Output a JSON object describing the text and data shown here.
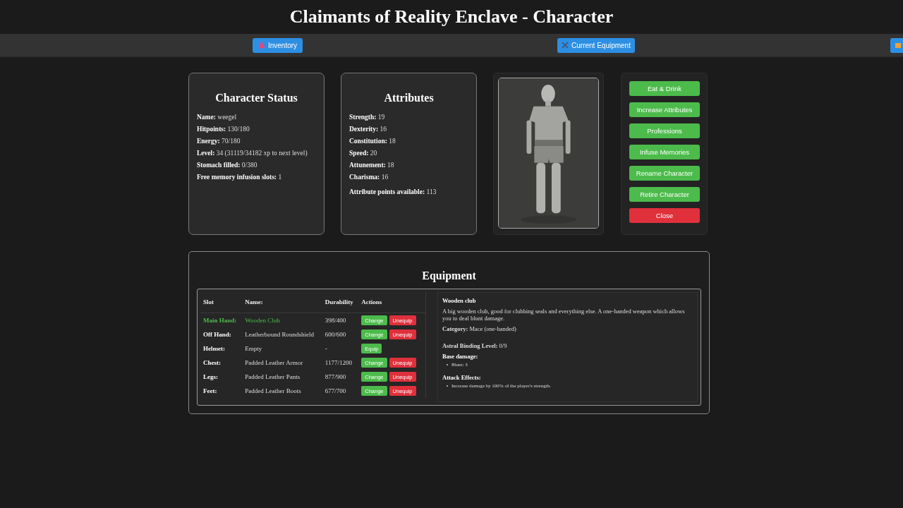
{
  "title": "Claimants of Reality Enclave - Character",
  "nav": [
    {
      "kind": "labeled",
      "label": "Inventory"
    },
    {
      "kind": "labeled",
      "label": "Current Equipment"
    },
    {
      "kind": "icon"
    }
  ],
  "status": {
    "title": "Character Status",
    "fields": [
      {
        "label": "Name:",
        "value": "weegel"
      },
      {
        "label": "Hitpoints:",
        "value": "130/180"
      },
      {
        "label": "Energy:",
        "value": "70/180"
      },
      {
        "label": "Level:",
        "value": "34 (31119/34182 xp to next level)"
      },
      {
        "label": "Stomach filled:",
        "value": "0/380"
      },
      {
        "label": "Free memory infusion slots:",
        "value": "1"
      }
    ]
  },
  "attributes": {
    "title": "Attributes",
    "fields": [
      {
        "label": "Strength:",
        "value": "19"
      },
      {
        "label": "Dexterity:",
        "value": "16"
      },
      {
        "label": "Constitution:",
        "value": "18"
      },
      {
        "label": "Speed:",
        "value": "20"
      },
      {
        "label": "Attunement:",
        "value": "18"
      },
      {
        "label": "Charisma:",
        "value": "16"
      }
    ],
    "points": {
      "label": "Attribute points available:",
      "value": "113"
    }
  },
  "actions": [
    {
      "label": "Eat & Drink",
      "kind": "primary"
    },
    {
      "label": "Increase Attributes",
      "kind": "primary"
    },
    {
      "label": "Professions",
      "kind": "primary"
    },
    {
      "label": "Infuse Memories",
      "kind": "primary"
    },
    {
      "label": "Rename Character",
      "kind": "primary"
    },
    {
      "label": "Retire Character",
      "kind": "primary"
    },
    {
      "label": "Close",
      "kind": "danger"
    }
  ],
  "equipment": {
    "title": "Equipment",
    "columns": [
      "Slot",
      "Name:",
      "Durability",
      "Actions"
    ],
    "rows": [
      {
        "slot": "Main Hand:",
        "name": "Wooden Club",
        "durability": "398/400",
        "selected": true,
        "actions": [
          {
            "label": "Change",
            "kind": "primary"
          },
          {
            "label": "Unequip",
            "kind": "danger"
          }
        ]
      },
      {
        "slot": "Off Hand:",
        "name": "Leatherbound Roundshield",
        "durability": "600/600",
        "selected": false,
        "actions": [
          {
            "label": "Change",
            "kind": "primary"
          },
          {
            "label": "Unequip",
            "kind": "danger"
          }
        ]
      },
      {
        "slot": "Helmet:",
        "name": "Empty",
        "durability": "-",
        "selected": false,
        "actions": [
          {
            "label": "Equip",
            "kind": "primary"
          }
        ]
      },
      {
        "slot": "Chest:",
        "name": "Padded Leather Armor",
        "durability": "1177/1200",
        "selected": false,
        "actions": [
          {
            "label": "Change",
            "kind": "primary"
          },
          {
            "label": "Unequip",
            "kind": "danger"
          }
        ]
      },
      {
        "slot": "Legs:",
        "name": "Padded Leather Pants",
        "durability": "877/900",
        "selected": false,
        "actions": [
          {
            "label": "Change",
            "kind": "primary"
          },
          {
            "label": "Unequip",
            "kind": "danger"
          }
        ]
      },
      {
        "slot": "Feet:",
        "name": "Padded Leather Boots",
        "durability": "677/700",
        "selected": false,
        "actions": [
          {
            "label": "Change",
            "kind": "primary"
          },
          {
            "label": "Unequip",
            "kind": "danger"
          }
        ]
      }
    ],
    "details": {
      "name": "Wooden club",
      "description": "A big wooden club, good for clubbing seals and everything else. A one-handed weapon which allows you to deal blunt damage.",
      "category": {
        "label": "Category:",
        "value": "Mace (one-handed)"
      },
      "binding": {
        "label": "Astral Binding Level:",
        "value": "0/9"
      },
      "base_damage": {
        "label": "Base damage:",
        "items": [
          "Blunt: 3"
        ]
      },
      "attack_effects": {
        "label": "Attack Effects:",
        "items": [
          "Increase damage by 100% of the player's strength."
        ]
      }
    }
  }
}
